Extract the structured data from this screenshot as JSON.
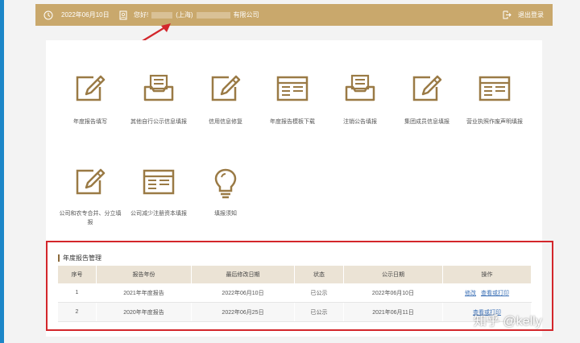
{
  "header": {
    "date": "2022年06月10日",
    "greeting": "您好!",
    "company_region": "(上海)",
    "company_suffix": "有限公司",
    "logout": "退出登录"
  },
  "tiles_row1": [
    {
      "label": "年度报告填写",
      "icon": "pencil-doc-icon"
    },
    {
      "label": "其他自行公示信息填报",
      "icon": "inbox-tray-icon"
    },
    {
      "label": "信用信息修复",
      "icon": "pencil-doc-icon"
    },
    {
      "label": "年度报告模板下载",
      "icon": "browser-window-icon"
    },
    {
      "label": "注销公告填报",
      "icon": "inbox-tray-icon"
    },
    {
      "label": "集团成员信息填报",
      "icon": "pencil-doc-icon"
    },
    {
      "label": "营业执照作废声明填报",
      "icon": "browser-window-icon"
    }
  ],
  "tiles_row2": [
    {
      "label": "公司和农专合并、分立填报",
      "icon": "pencil-doc-icon"
    },
    {
      "label": "公司减少注册资本填报",
      "icon": "browser-window-icon"
    },
    {
      "label": "填报须知",
      "icon": "lightbulb-icon"
    }
  ],
  "report_section": {
    "title": "年度报告管理",
    "columns": [
      "序号",
      "报告年份",
      "最后修改日期",
      "状态",
      "公示日期",
      "操作"
    ],
    "rows": [
      {
        "no": "1",
        "year": "2021年年度报告",
        "modified": "2022年06月10日",
        "status": "已公示",
        "published": "2022年06月10日",
        "actions": [
          "修改",
          "查看或打印"
        ]
      },
      {
        "no": "2",
        "year": "2020年年度报告",
        "modified": "2022年06月25日",
        "status": "已公示",
        "published": "2021年06月11日",
        "actions": [
          "查看或打印"
        ]
      }
    ]
  },
  "watermark": "知乎 @kelly",
  "colors": {
    "gold": "#c9a86c",
    "icon": "#9a7a45",
    "annotation_red": "#d3262b"
  }
}
